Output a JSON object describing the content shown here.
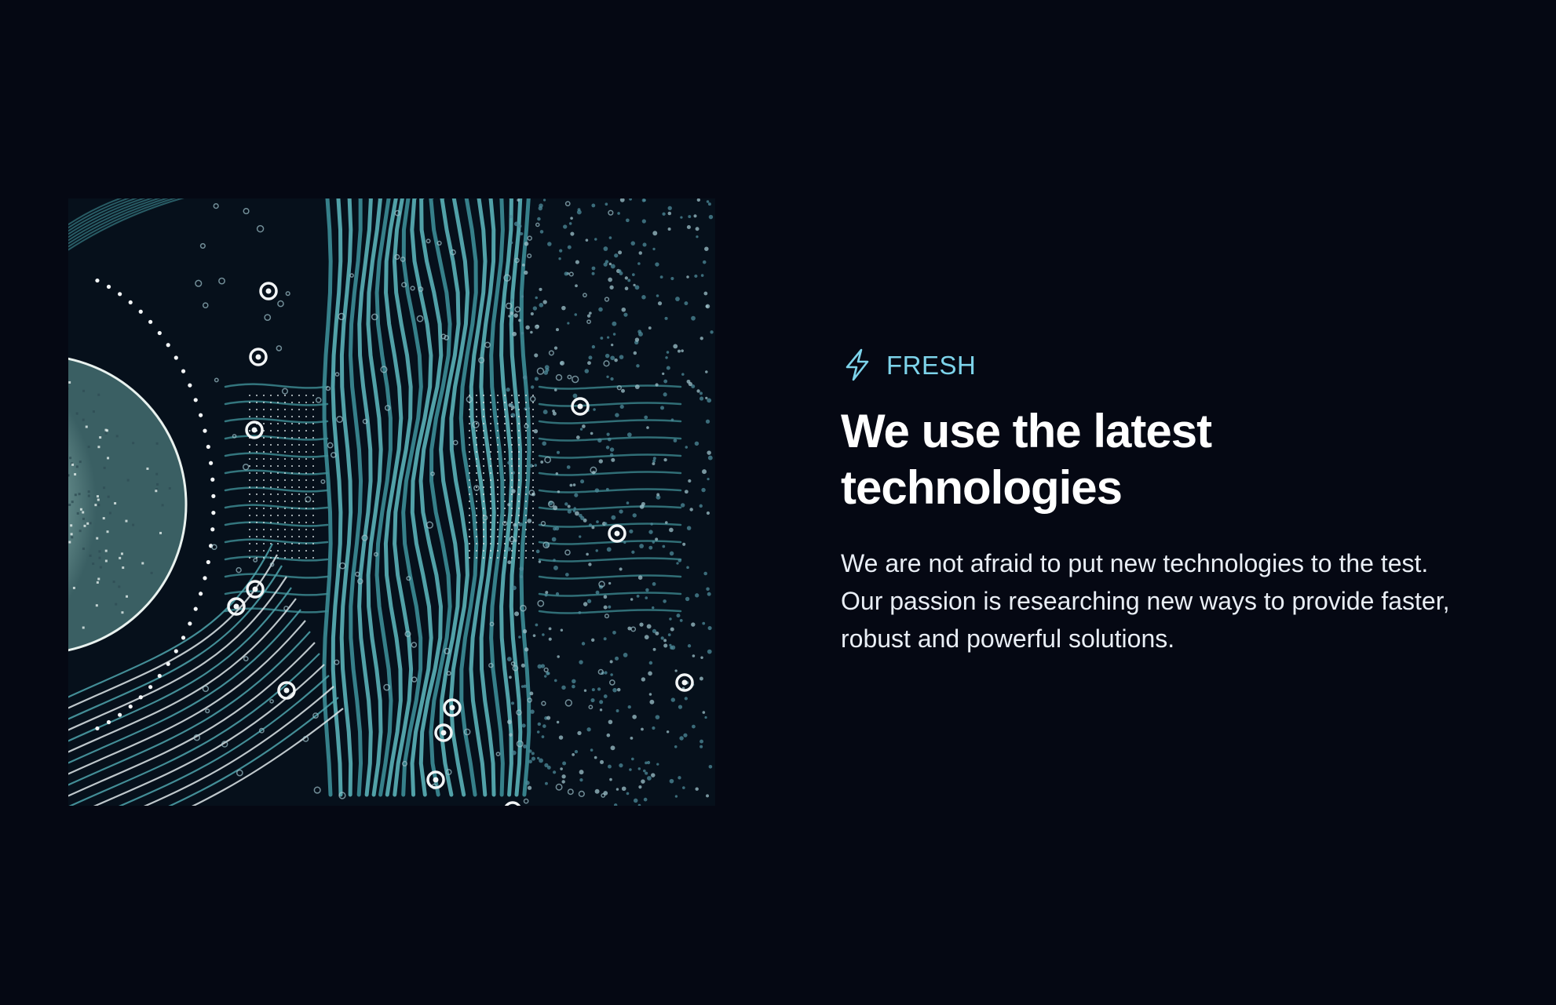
{
  "feature": {
    "image": {
      "alt": "Circuit board illustration",
      "icon": "circuit-board-art"
    },
    "eyebrow": {
      "icon": "lightning-bolt-icon",
      "label": "FRESH"
    },
    "title": "We use the latest technologies",
    "description": "We are not afraid to put new technologies to the test. Our passion is researching new ways to provide faster, robust and powerful solutions."
  },
  "colors": {
    "background": "#050813",
    "accent": "#7dd3ea",
    "title": "#ffffff",
    "text": "#e9eef5",
    "circuit": "#4fa4ad"
  }
}
